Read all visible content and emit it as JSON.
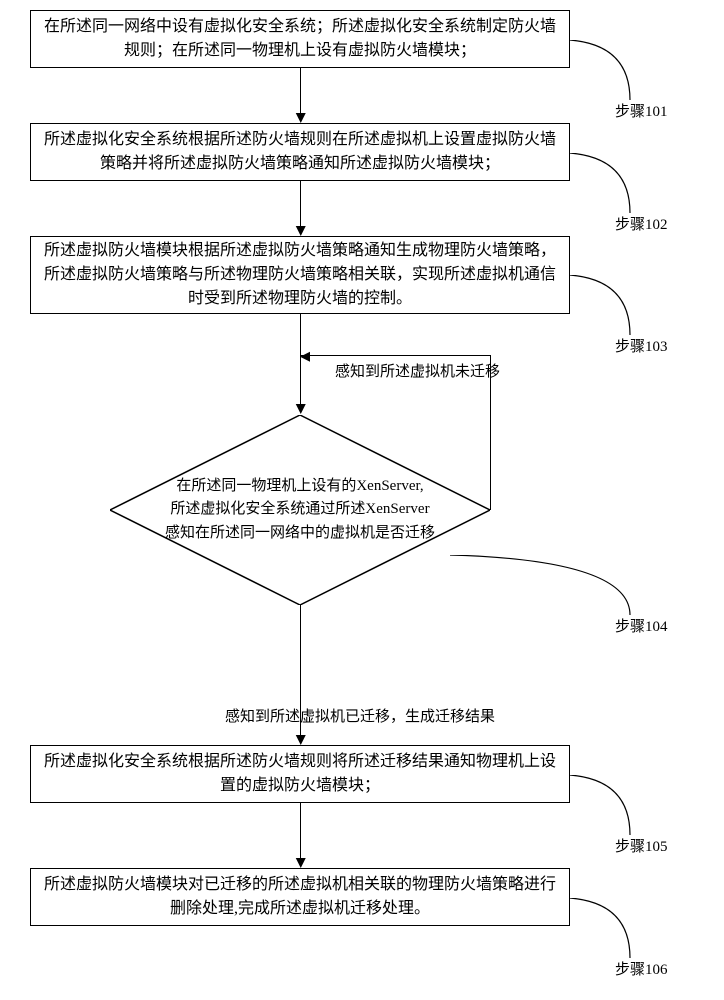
{
  "steps": {
    "s1": {
      "text": "在所述同一网络中设有虚拟化安全系统；所述虚拟化安全系统制定防火墙规则；在所述同一物理机上设有虚拟防火墙模块；",
      "label": "步骤101"
    },
    "s2": {
      "text": "所述虚拟化安全系统根据所述防火墙规则在所述虚拟机上设置虚拟防火墙策略并将所述虚拟防火墙策略通知所述虚拟防火墙模块；",
      "label": "步骤102"
    },
    "s3": {
      "text": "所述虚拟防火墙模块根据所述虚拟防火墙策略通知生成物理防火墙策略，所述虚拟防火墙策略与所述物理防火墙策略相关联，实现所述虚拟机通信时受到所述物理防火墙的控制。",
      "label": "步骤103"
    },
    "s4": {
      "text": "在所述同一物理机上设有的XenServer,\n所述虚拟化安全系统通过所述XenServer\n感知在所述同一网络中的虚拟机是否迁移",
      "label": "步骤104"
    },
    "s5": {
      "text": "所述虚拟化安全系统根据所述防火墙规则将所述迁移结果通知物理机上设置的虚拟防火墙模块；",
      "label": "步骤105"
    },
    "s6": {
      "text": "所述虚拟防火墙模块对已迁移的所述虚拟机相关联的物理防火墙策略进行删除处理,完成所述虚拟机迁移处理。",
      "label": "步骤106"
    }
  },
  "edges": {
    "loop_label": "感知到所述虚拟机未迁移",
    "yes_label": "感知到所述虚拟机已迁移，生成迁移结果"
  }
}
